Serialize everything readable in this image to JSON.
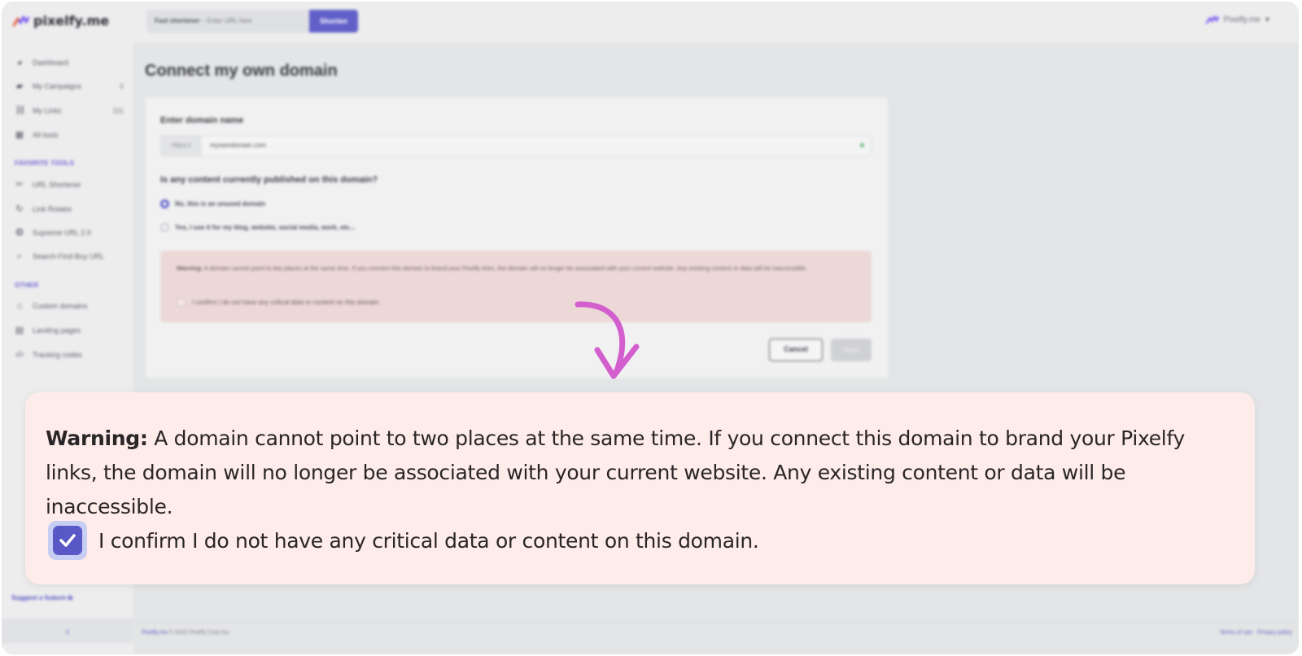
{
  "app": {
    "brand": "pixelfy.me",
    "account_name": "Pixelfy.me"
  },
  "topbar": {
    "shortener_label": "Fast shortener",
    "shortener_placeholder": "– Enter URL here",
    "shorten_button": "Shorten"
  },
  "sidebar": {
    "main_items": [
      {
        "label": "Dashboard",
        "count": "",
        "icon": "dashboard-icon"
      },
      {
        "label": "My Campaigns",
        "count": "5",
        "icon": "folder-icon"
      },
      {
        "label": "My Links",
        "count": "221",
        "icon": "link-icon"
      },
      {
        "label": "All tools",
        "count": "",
        "icon": "grid-icon"
      }
    ],
    "favorite_title": "FAVORITE TOOLS",
    "favorite_items": [
      {
        "label": "URL Shortener",
        "icon": "scissors-icon"
      },
      {
        "label": "Link Rotator",
        "icon": "rotate-icon"
      },
      {
        "label": "Supreme URL 2.0",
        "icon": "star-icon"
      },
      {
        "label": "Search-Find-Buy URL",
        "icon": "search-icon"
      }
    ],
    "other_title": "OTHER",
    "other_items": [
      {
        "label": "Custom domains",
        "icon": "home-icon"
      },
      {
        "label": "Landing pages",
        "icon": "page-icon"
      },
      {
        "label": "Tracking codes",
        "icon": "code-icon"
      }
    ],
    "suggest_label": "Suggest a feature",
    "collapse_label": "‹"
  },
  "page": {
    "title": "Connect my own domain",
    "domain_label": "Enter domain name",
    "domain_prefix": "https://",
    "domain_value": "myowndomain.com",
    "content_question": "Is any content currently published on this domain?",
    "option_unused": "No, this is an unused domain",
    "option_used": "Yes, I use it for my blog, website, social media, work, etc...",
    "warning_strong": "Warning:",
    "warning_text": "A domain cannot point to two places at the same time. If you connect this domain to brand your Pixelfy links, the domain will no longer be associated with your current website. Any existing content or data will be inaccessible.",
    "confirm_text": "I confirm I do not have any critical data or content on this domain.",
    "cancel_button": "Cancel",
    "next_button": "Next"
  },
  "footer": {
    "brand_link": "Pixelfy.me",
    "copyright": "© 2022 Pixelfy Corp Inc.",
    "links": "Terms of use · Privacy policy"
  },
  "callout": {
    "warning_strong": "Warning:",
    "warning_text": "A domain cannot point to two places at the same time. If you connect this domain to brand your Pixelfy links, the domain will no longer be associated with your current website. Any existing content or data will be inaccessible.",
    "confirm_text": "I confirm I do not have any critical data or content on this domain.",
    "confirm_checked": true
  },
  "colors": {
    "accent": "#5a57c6",
    "callout_bg": "#fdecea",
    "arrow": "#d35fcf"
  }
}
